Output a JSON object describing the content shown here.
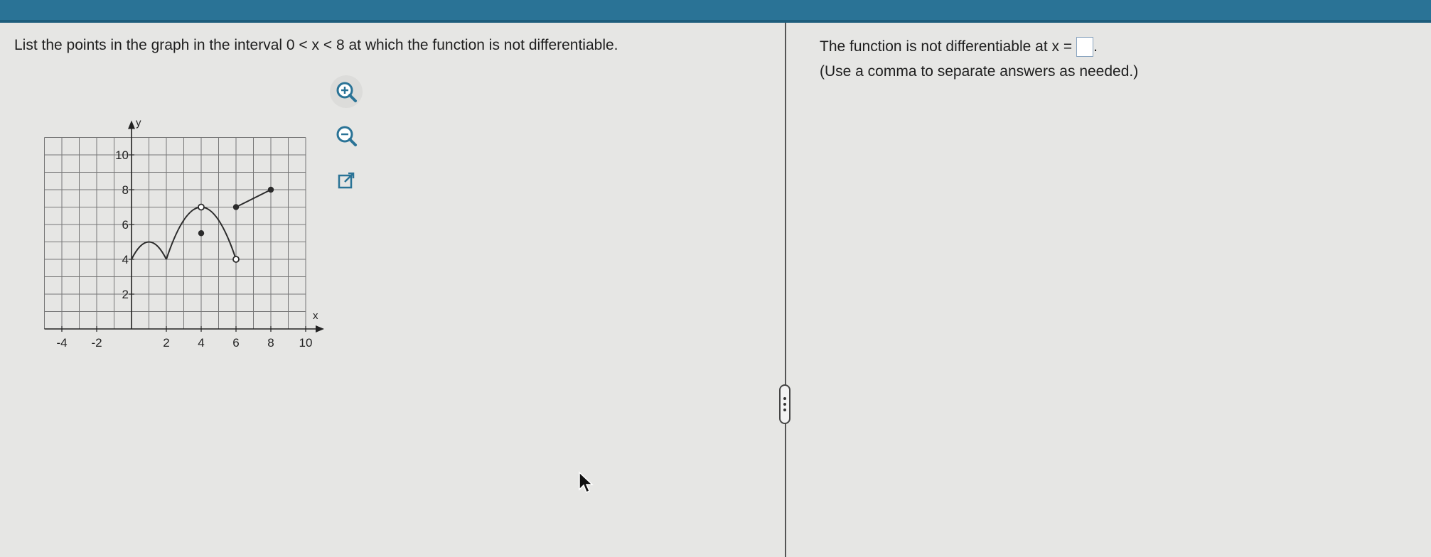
{
  "question": {
    "prefix": "List the points in the graph in the interval",
    "interval": "0 < x < 8",
    "suffix": "at which the function is not differentiable."
  },
  "answer": {
    "prompt": "The function is not differentiable at x =",
    "value": "",
    "period": ".",
    "hint": "(Use a comma to separate answers as needed.)"
  },
  "tools": [
    {
      "name": "zoom-in",
      "icon": "zoom-in-icon"
    },
    {
      "name": "zoom-out",
      "icon": "zoom-out-icon"
    },
    {
      "name": "open-external",
      "icon": "external-link-icon"
    }
  ],
  "colors": {
    "header": "#2a7396",
    "accent": "#2a7396",
    "curve": "#2b2b2b"
  },
  "chart_data": {
    "type": "line",
    "xlabel": "x",
    "ylabel": "y",
    "xlim": [
      -5,
      10
    ],
    "ylim": [
      0,
      11
    ],
    "x_ticks": [
      "-4",
      "-2",
      "2",
      "4",
      "6",
      "8",
      "10"
    ],
    "y_ticks": [
      "2",
      "4",
      "6",
      "8",
      "10"
    ],
    "grid": true,
    "segments": [
      {
        "kind": "arc",
        "from": [
          0,
          4
        ],
        "peak": [
          1,
          5
        ],
        "to": [
          2,
          4
        ]
      },
      {
        "kind": "arc",
        "from": [
          2,
          4
        ],
        "peak": [
          4,
          7
        ],
        "to": [
          6,
          4
        ]
      },
      {
        "kind": "line",
        "from": [
          6,
          7
        ],
        "to": [
          8,
          8
        ]
      }
    ],
    "points": [
      {
        "x": 4,
        "y": 7,
        "style": "open"
      },
      {
        "x": 4,
        "y": 5.5,
        "style": "closed"
      },
      {
        "x": 6,
        "y": 4,
        "style": "open"
      },
      {
        "x": 6,
        "y": 7,
        "style": "closed"
      },
      {
        "x": 8,
        "y": 8,
        "style": "closed"
      }
    ]
  }
}
